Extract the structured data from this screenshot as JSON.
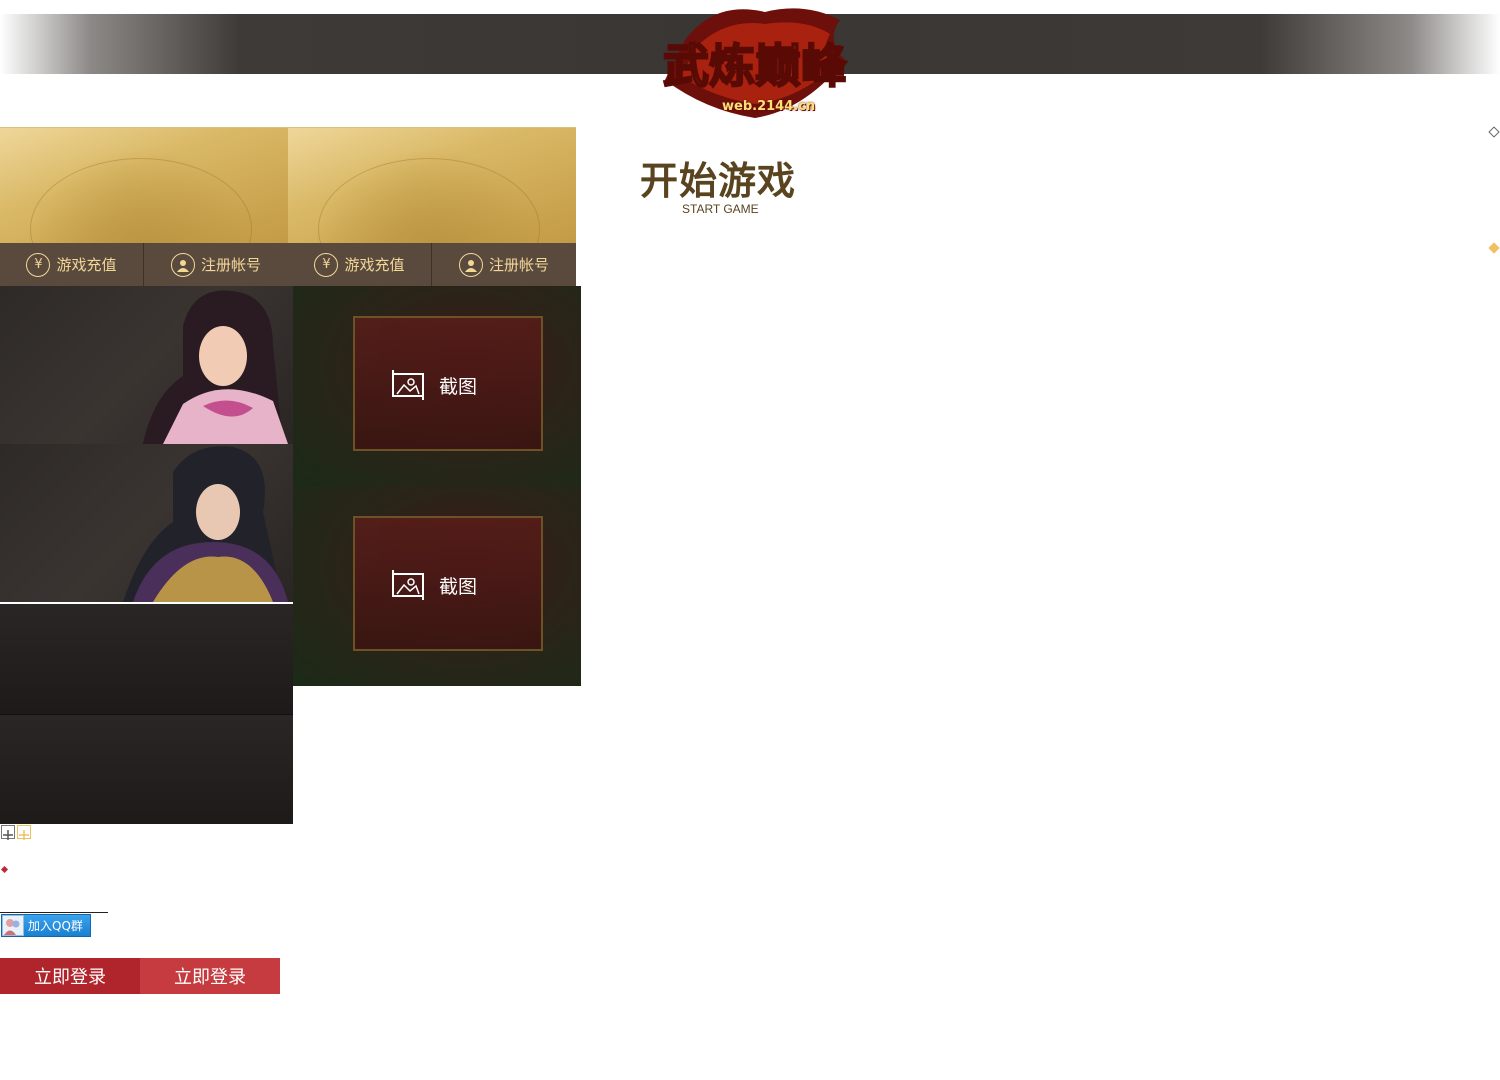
{
  "header": {
    "logo_title": "武炼巅峰",
    "logo_sub": "web.2144.cn"
  },
  "links": {
    "recharge": "游戏充值",
    "register": "注册帐号"
  },
  "screenshot_label": "截图",
  "start": {
    "title": "开始游戏",
    "subtitle": "START GAME"
  },
  "qq_group": "加入QQ群",
  "login_label": "立即登录",
  "colors": {
    "header_bar": "#3a3634",
    "gold": "#d9b865",
    "button_bar": "#5a4a3e",
    "button_text": "#f3d797",
    "login_dark": "#b0242c",
    "login_light": "#c53b40",
    "title": "#5a4420"
  }
}
